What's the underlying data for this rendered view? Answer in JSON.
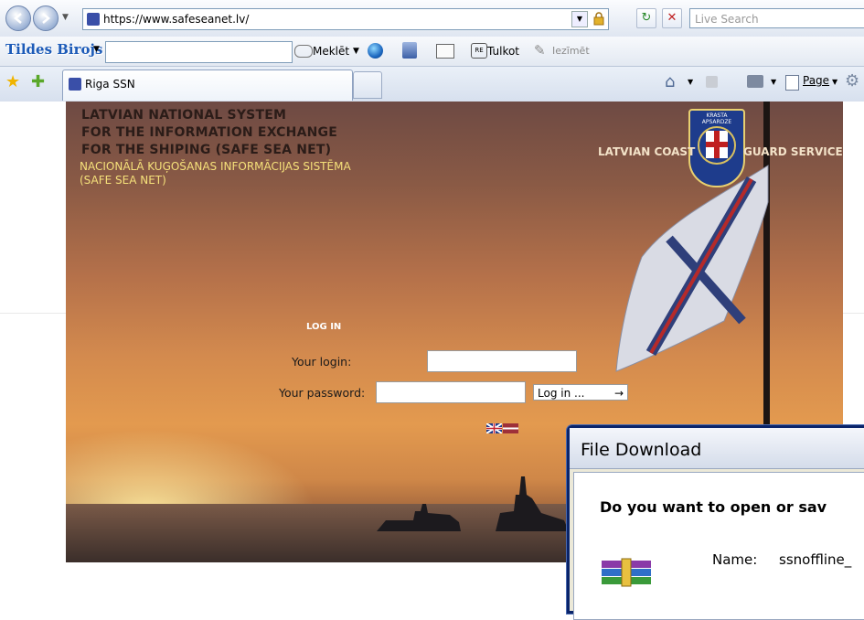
{
  "browser": {
    "url": "https://www.safeseanet.lv/",
    "live_search_placeholder": "Live Search",
    "toolbar": {
      "brand": "Tildes Birojs",
      "search_label": "Meklēt",
      "translate_label": "Tulkot",
      "insert_label": "Iezīmēt"
    },
    "tab": {
      "title": "Riga SSN"
    },
    "page_menu_label": "Page"
  },
  "page": {
    "title_lines": [
      "LATVIAN NATIONAL SYSTEM",
      "FOR THE INFORMATION EXCHANGE",
      "FOR THE SHIPING (SAFE SEA NET)"
    ],
    "subtitle_lines": [
      "NACIONĀLĀ KUĢOŠANAS INFORMĀCIJAS SISTĒMA",
      "(SAFE SEA NET)"
    ],
    "coast_guard_left": "LATVIAN COAST",
    "coast_guard_right": "GUARD SERVICE",
    "emblem_text": "KRASTA APSARDZE",
    "login": {
      "heading": "LOG IN",
      "login_label": "Your login:",
      "password_label": "Your password:",
      "login_value": "",
      "password_value": "",
      "button_label": "Log in ...",
      "button_arrow": "→"
    }
  },
  "dialog": {
    "title": "File Download",
    "question": "Do you want to open or sav",
    "name_label": "Name:",
    "name_value": "ssnoffline_"
  },
  "colors": {
    "dialog_border": "#0a246a",
    "subtitle": "#f5e07a",
    "sky_top": "#6e4a44",
    "sky_horizon": "#e39a4f"
  }
}
